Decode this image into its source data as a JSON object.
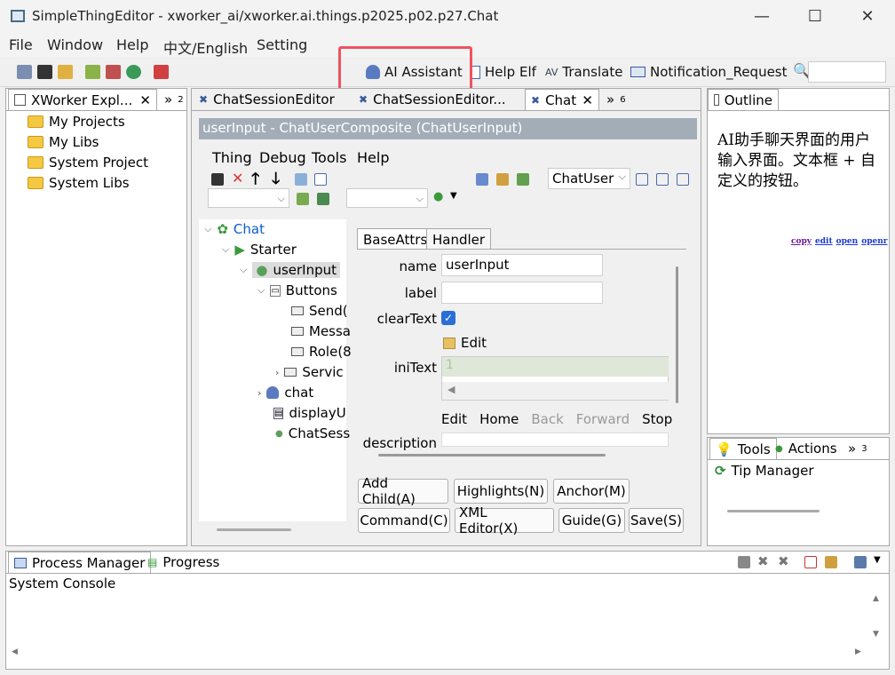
{
  "window": {
    "title": "SimpleThingEditor - xworker_ai/xworker.ai.things.p2025.p02.p27.Chat",
    "minimize": "—",
    "maximize": "☐",
    "close": "✕"
  },
  "menu": [
    "File",
    "Window",
    "Help",
    "中文/English",
    "Setting"
  ],
  "toolbar": {
    "ai_assistant": "AI Assistant",
    "help_elf": "Help Elf",
    "translate": "Translate",
    "notification": "Notification_Request",
    "search_value": ""
  },
  "explorer": {
    "tab": "XWorker Expl...",
    "overflow": "»",
    "overflow_count": "2",
    "items": [
      "My Projects",
      "My Libs",
      "System Project",
      "System Libs"
    ]
  },
  "editor_tabs": [
    {
      "label": "ChatSessionEditor"
    },
    {
      "label": "ChatSessionEditor..."
    },
    {
      "label": "Chat"
    }
  ],
  "editor_overflow": "»",
  "editor_overflow_count": "6",
  "editor": {
    "header": "userInput - ChatUserComposite  (ChatUserInput)",
    "menu": [
      "Thing",
      "Debug",
      "Tools",
      "Help"
    ],
    "chatuser_select": "ChatUser",
    "tree": [
      {
        "label": "Chat"
      },
      {
        "label": "Starter"
      },
      {
        "label": "userInput"
      },
      {
        "label": "Buttons"
      },
      {
        "label": "Send("
      },
      {
        "label": "Messa"
      },
      {
        "label": "Role(8"
      },
      {
        "label": "Servic"
      },
      {
        "label": "chat"
      },
      {
        "label": "displayU"
      },
      {
        "label": "ChatSess"
      }
    ],
    "attr_tabs": [
      "BaseAttrs",
      "Handler"
    ],
    "fields": {
      "name_label": "name",
      "name_value": "userInput",
      "label_label": "label",
      "label_value": "",
      "clearText_label": "clearText",
      "edit_label": "Edit",
      "iniText_label": "iniText",
      "iniText_line": "1",
      "description_label": "description"
    },
    "browser_bar": [
      "Edit",
      "Home",
      "Back",
      "Forward",
      "Stop"
    ],
    "buttons_row1": [
      "Add Child(A)",
      "Highlights(N)",
      "Anchor(M)"
    ],
    "buttons_row2": [
      "Command(C)",
      "XML Editor(X)",
      "Guide(G)",
      "Save(S)"
    ]
  },
  "outline": {
    "tab": "Outline",
    "text": "AI助手聊天界面的用户输入界面。文本框 + 自定义的按钮。",
    "links": [
      "copy",
      "edit",
      "open",
      "openr"
    ]
  },
  "tools": {
    "tabs": [
      "Tools",
      "Actions"
    ],
    "overflow": "»",
    "overflow_count": "3",
    "item": "Tip Manager"
  },
  "bottom": {
    "tabs": [
      "Process Manager",
      "Progress"
    ],
    "console_label": "System Console"
  },
  "colors": {
    "accent": "#0066cc",
    "highlight": "#ef5360",
    "header_bg": "#a3adb8",
    "check": "#2a6fd6"
  }
}
